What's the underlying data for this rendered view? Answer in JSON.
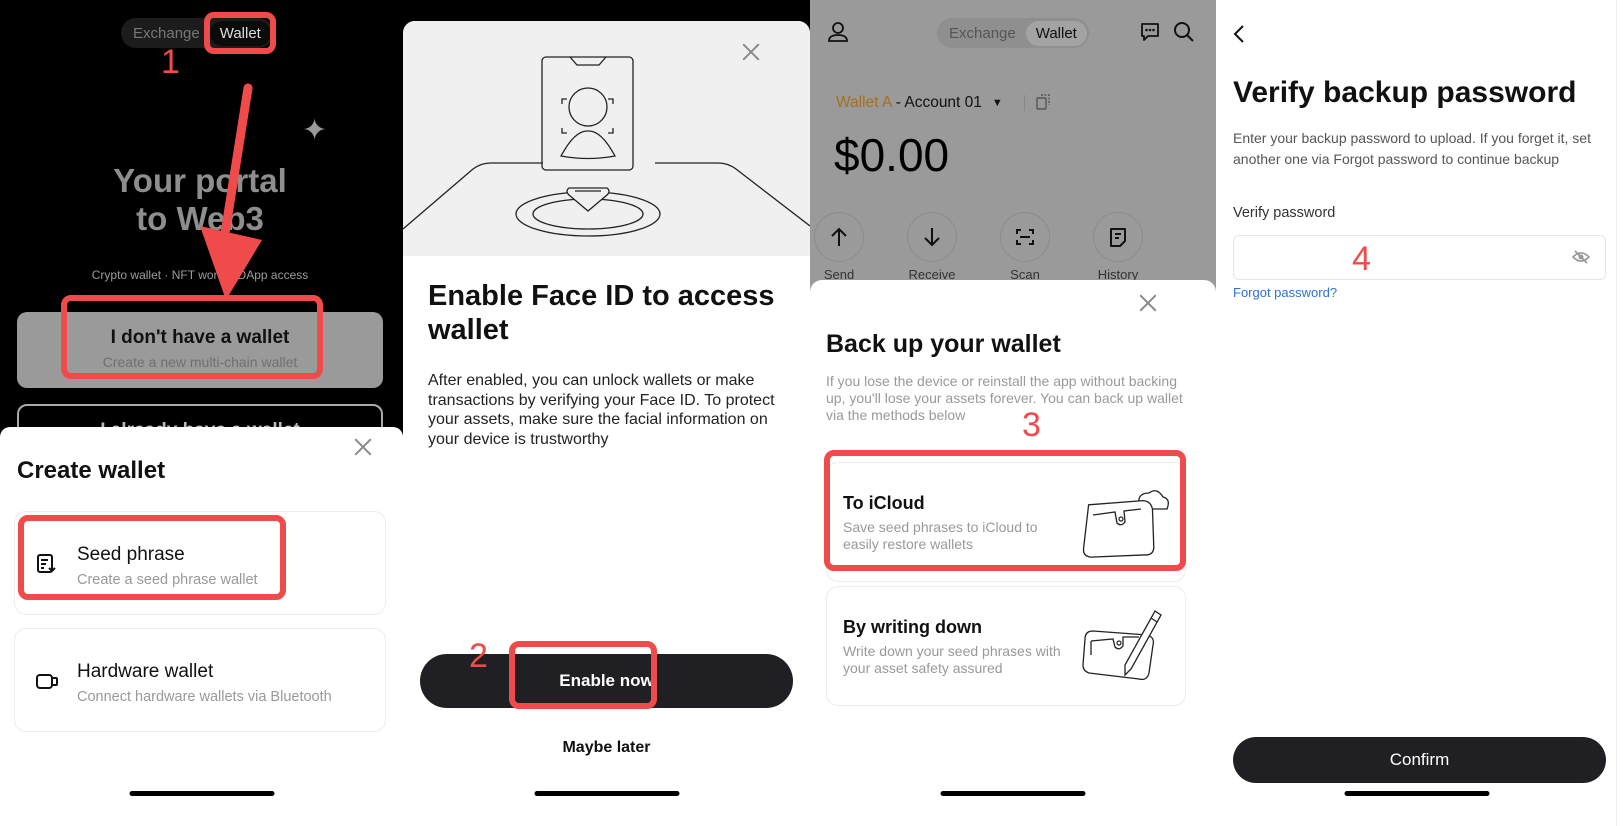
{
  "annotations": {
    "color": "#f04b4b",
    "steps": [
      "1",
      "2",
      "3",
      "4"
    ]
  },
  "screen1": {
    "tabs": [
      {
        "label": "Exchange",
        "active": false
      },
      {
        "label": "Wallet",
        "active": true
      }
    ],
    "hero_line1": "Your portal",
    "hero_line2": "to Web3",
    "sparkle_icon": "✦",
    "tagline": "Crypto wallet · NFT world · DApp access",
    "no_wallet_button": {
      "title": "I don't have a wallet",
      "subtitle": "Create a new multi-chain wallet"
    },
    "have_wallet_button": {
      "title": "I already have a wallet"
    },
    "sheet": {
      "title": "Create wallet",
      "options": [
        {
          "icon": "seed-phrase-icon",
          "title": "Seed phrase",
          "subtitle": "Create a seed phrase wallet"
        },
        {
          "icon": "hardware-wallet-icon",
          "title": "Hardware wallet",
          "subtitle": "Connect hardware wallets via Bluetooth"
        }
      ]
    }
  },
  "screen2": {
    "illustration": "face-id-illustration",
    "title": "Enable Face ID to access wallet",
    "description": "After enabled, you can unlock wallets or make transactions by verifying your Face ID. To protect your assets, make sure the facial information on your device is trustworthy",
    "primary_button": "Enable now",
    "secondary_button": "Maybe later"
  },
  "screen3": {
    "tabs": [
      {
        "label": "Exchange",
        "active": false
      },
      {
        "label": "Wallet",
        "active": true
      }
    ],
    "wallet_name": "Wallet A",
    "account_name": " - Account 01",
    "wallet_name_color": "#a86f1c",
    "balance": "$0.00",
    "actions": [
      {
        "icon": "arrow-up-icon",
        "label": "Send"
      },
      {
        "icon": "arrow-down-icon",
        "label": "Receive"
      },
      {
        "icon": "scan-icon",
        "label": "Scan"
      },
      {
        "icon": "history-icon",
        "label": "History"
      }
    ],
    "sheet": {
      "title": "Back up your wallet",
      "description": "If you lose the device or reinstall the app without backing up, you'll lose your assets forever. You can back up wallet via the methods below",
      "options": [
        {
          "title": "To iCloud",
          "subtitle": "Save seed phrases to iCloud to easily restore wallets"
        },
        {
          "title": "By writing down",
          "subtitle": "Write down your seed phrases with your asset safety assured"
        }
      ]
    }
  },
  "screen4": {
    "title": "Verify backup password",
    "description": "Enter your backup password to upload. If you forget it, set another one via Forgot password to continue backup",
    "field_label": "Verify password",
    "field_value": "",
    "field_placeholder": "",
    "forgot_link": "Forgot password?",
    "confirm_button": "Confirm"
  }
}
